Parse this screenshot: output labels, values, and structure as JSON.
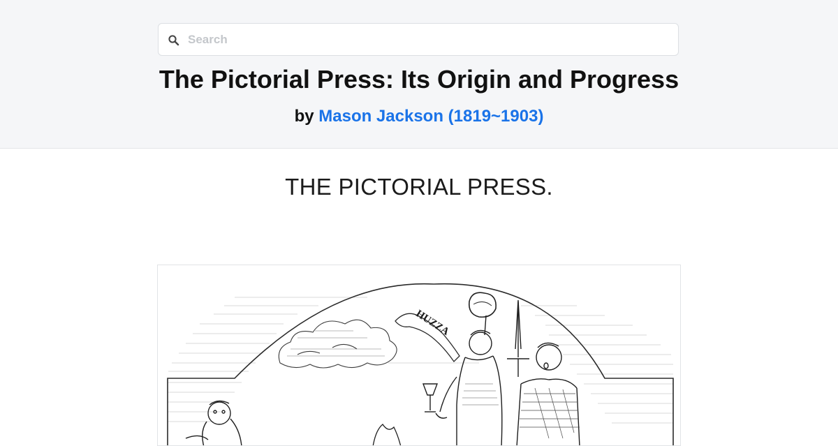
{
  "search": {
    "placeholder": "Search",
    "value": ""
  },
  "book": {
    "title": "The Pictorial Press: Its Origin and Progress",
    "by_label": "by",
    "author": "Mason Jackson (1819~1903)"
  },
  "content": {
    "chapter_heading": "THE PICTORIAL PRESS.",
    "illustration": {
      "banner_text": "HUZZA"
    }
  },
  "icons": {
    "search": "search-icon"
  },
  "colors": {
    "header_bg": "#f5f6f8",
    "link": "#1a73e8",
    "text": "#111111"
  }
}
